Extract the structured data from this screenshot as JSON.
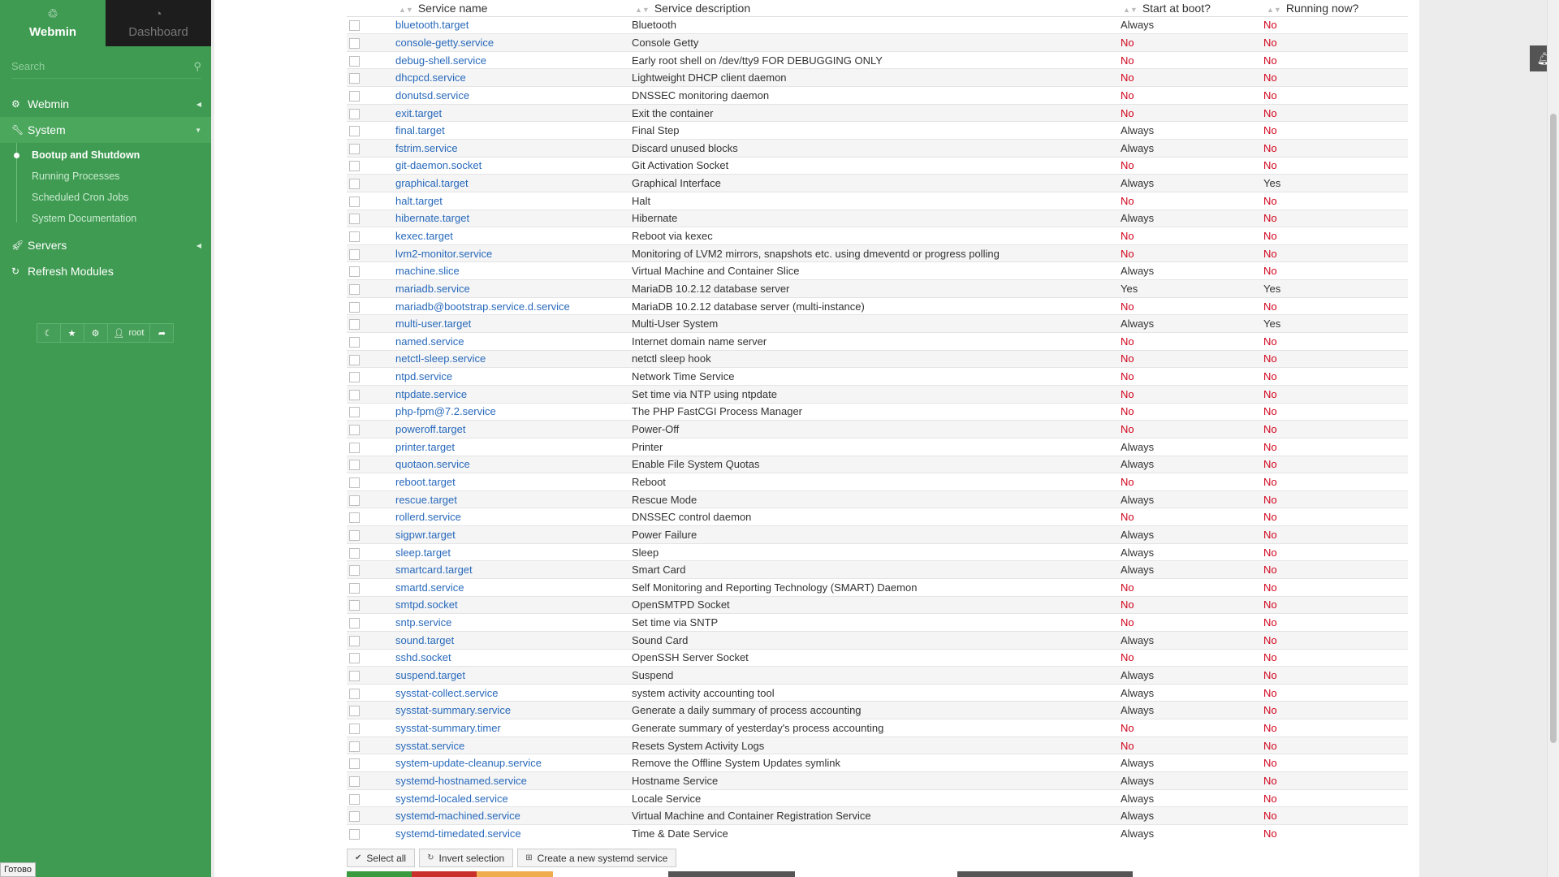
{
  "sidebar": {
    "tabs": [
      {
        "label": "Webmin",
        "icon": "webmin-logo-icon"
      },
      {
        "label": "Dashboard",
        "icon": "dashboard-gauge-icon"
      }
    ],
    "search_placeholder": "Search",
    "menu": [
      {
        "label": "Webmin",
        "icon": "gear-icon"
      },
      {
        "label": "System",
        "icon": "wrench-icon"
      },
      {
        "label": "Servers",
        "icon": "rocket-icon"
      },
      {
        "label": "Refresh Modules",
        "icon": "refresh-icon"
      }
    ],
    "system_submenu": [
      "Bootup and Shutdown",
      "Running Processes",
      "Scheduled Cron Jobs",
      "System Documentation"
    ],
    "user": "root",
    "status": "Готово"
  },
  "table": {
    "headers": [
      "Service name",
      "Service description",
      "Start at boot?",
      "Running now?"
    ],
    "rows": [
      [
        "bluetooth.target",
        "Bluetooth",
        "Always",
        "No"
      ],
      [
        "console-getty.service",
        "Console Getty",
        "No",
        "No"
      ],
      [
        "debug-shell.service",
        "Early root shell on /dev/tty9 FOR DEBUGGING ONLY",
        "No",
        "No"
      ],
      [
        "dhcpcd.service",
        "Lightweight DHCP client daemon",
        "No",
        "No"
      ],
      [
        "donutsd.service",
        "DNSSEC monitoring daemon",
        "No",
        "No"
      ],
      [
        "exit.target",
        "Exit the container",
        "No",
        "No"
      ],
      [
        "final.target",
        "Final Step",
        "Always",
        "No"
      ],
      [
        "fstrim.service",
        "Discard unused blocks",
        "Always",
        "No"
      ],
      [
        "git-daemon.socket",
        "Git Activation Socket",
        "No",
        "No"
      ],
      [
        "graphical.target",
        "Graphical Interface",
        "Always",
        "Yes"
      ],
      [
        "halt.target",
        "Halt",
        "No",
        "No"
      ],
      [
        "hibernate.target",
        "Hibernate",
        "Always",
        "No"
      ],
      [
        "kexec.target",
        "Reboot via kexec",
        "No",
        "No"
      ],
      [
        "lvm2-monitor.service",
        "Monitoring of LVM2 mirrors, snapshots etc. using dmeventd or progress polling",
        "No",
        "No"
      ],
      [
        "machine.slice",
        "Virtual Machine and Container Slice",
        "Always",
        "No"
      ],
      [
        "mariadb.service",
        "MariaDB 10.2.12 database server",
        "Yes",
        "Yes"
      ],
      [
        "mariadb@bootstrap.service.d.service",
        "MariaDB 10.2.12 database server (multi-instance)",
        "No",
        "No"
      ],
      [
        "multi-user.target",
        "Multi-User System",
        "Always",
        "Yes"
      ],
      [
        "named.service",
        "Internet domain name server",
        "No",
        "No"
      ],
      [
        "netctl-sleep.service",
        "netctl sleep hook",
        "No",
        "No"
      ],
      [
        "ntpd.service",
        "Network Time Service",
        "No",
        "No"
      ],
      [
        "ntpdate.service",
        "Set time via NTP using ntpdate",
        "No",
        "No"
      ],
      [
        "php-fpm@7.2.service",
        "The PHP FastCGI Process Manager",
        "No",
        "No"
      ],
      [
        "poweroff.target",
        "Power-Off",
        "No",
        "No"
      ],
      [
        "printer.target",
        "Printer",
        "Always",
        "No"
      ],
      [
        "quotaon.service",
        "Enable File System Quotas",
        "Always",
        "No"
      ],
      [
        "reboot.target",
        "Reboot",
        "No",
        "No"
      ],
      [
        "rescue.target",
        "Rescue Mode",
        "Always",
        "No"
      ],
      [
        "rollerd.service",
        "DNSSEC control daemon",
        "No",
        "No"
      ],
      [
        "sigpwr.target",
        "Power Failure",
        "Always",
        "No"
      ],
      [
        "sleep.target",
        "Sleep",
        "Always",
        "No"
      ],
      [
        "smartcard.target",
        "Smart Card",
        "Always",
        "No"
      ],
      [
        "smartd.service",
        "Self Monitoring and Reporting Technology (SMART) Daemon",
        "No",
        "No"
      ],
      [
        "smtpd.socket",
        "OpenSMTPD Socket",
        "No",
        "No"
      ],
      [
        "sntp.service",
        "Set time via SNTP",
        "No",
        "No"
      ],
      [
        "sound.target",
        "Sound Card",
        "Always",
        "No"
      ],
      [
        "sshd.socket",
        "OpenSSH Server Socket",
        "No",
        "No"
      ],
      [
        "suspend.target",
        "Suspend",
        "Always",
        "No"
      ],
      [
        "sysstat-collect.service",
        "system activity accounting tool",
        "Always",
        "No"
      ],
      [
        "sysstat-summary.service",
        "Generate a daily summary of process accounting",
        "Always",
        "No"
      ],
      [
        "sysstat-summary.timer",
        "Generate summary of yesterday's process accounting",
        "No",
        "No"
      ],
      [
        "sysstat.service",
        "Resets System Activity Logs",
        "No",
        "No"
      ],
      [
        "system-update-cleanup.service",
        "Remove the Offline System Updates symlink",
        "Always",
        "No"
      ],
      [
        "systemd-hostnamed.service",
        "Hostname Service",
        "Always",
        "No"
      ],
      [
        "systemd-localed.service",
        "Locale Service",
        "Always",
        "No"
      ],
      [
        "systemd-machined.service",
        "Virtual Machine and Container Registration Service",
        "Always",
        "No"
      ],
      [
        "systemd-timedated.service",
        "Time & Date Service",
        "Always",
        "No"
      ]
    ]
  },
  "actions": [
    "Select all",
    "Invert selection",
    "Create a new systemd service"
  ],
  "bottom_strip_colors": [
    "#3a9a3e",
    "#c9302c",
    "#f0ad4e",
    "#ffffff",
    "#555555",
    "#ffffff",
    "#555555"
  ],
  "colors": {
    "sidebar": "#3f9b52",
    "link": "#2869bb",
    "no": "#d0021b"
  }
}
